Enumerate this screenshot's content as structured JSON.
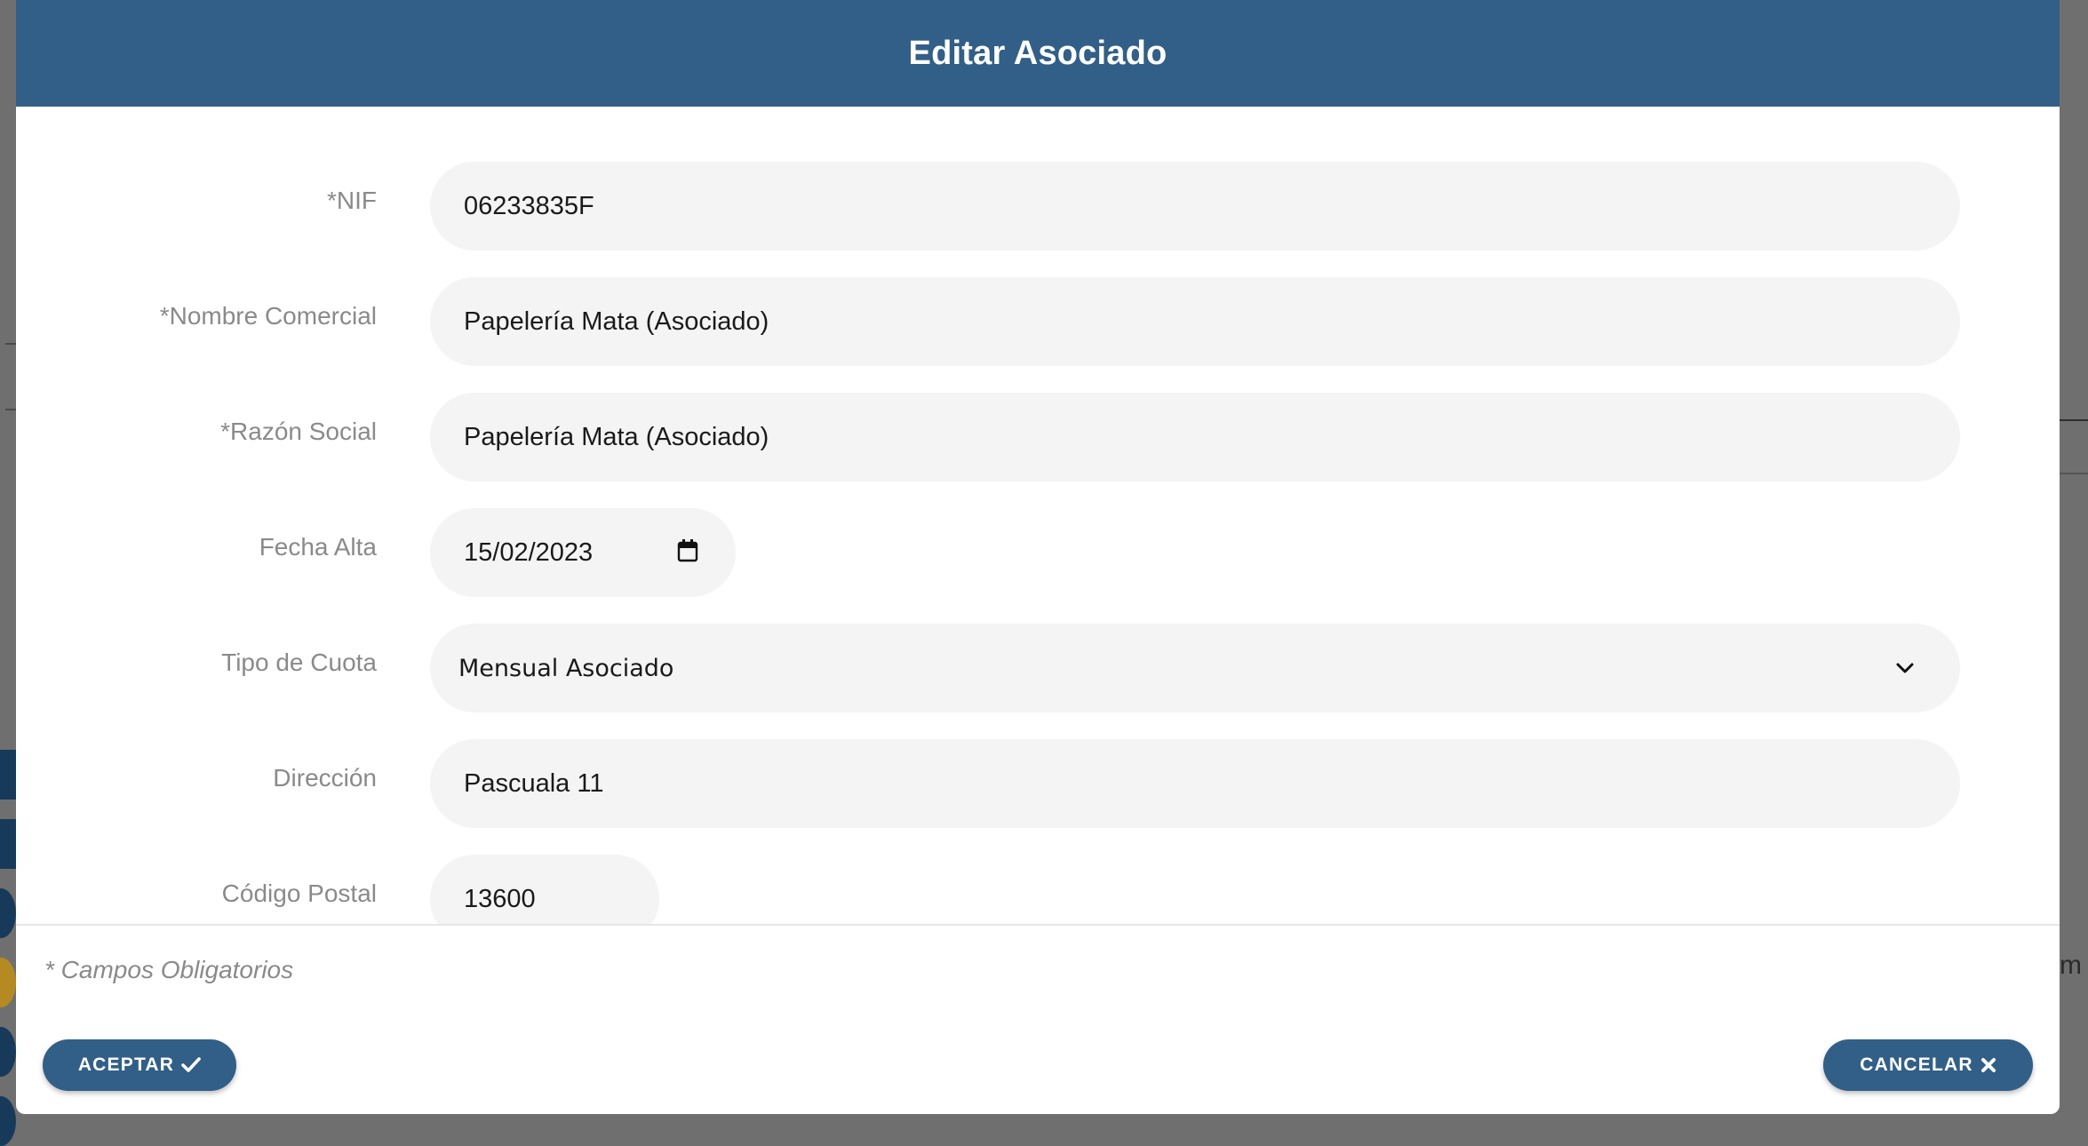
{
  "modal": {
    "title": "Editar Asociado"
  },
  "form": {
    "fields": [
      {
        "label": "*NIF",
        "value": "06233835F"
      },
      {
        "label": "*Nombre Comercial",
        "value": "Papelería Mata (Asociado)"
      },
      {
        "label": "*Razón Social",
        "value": "Papelería Mata (Asociado)"
      },
      {
        "label": "Fecha Alta",
        "value": "15/02/2023",
        "icon": "calendar-icon"
      },
      {
        "label": "Tipo de Cuota",
        "value": "Mensual Asociado",
        "icon": "chevron-down-icon"
      },
      {
        "label": "Dirección",
        "value": "Pascuala 11"
      },
      {
        "label": "Código Postal",
        "value": "13600"
      }
    ]
  },
  "footer": {
    "required_note": "* Campos Obligatorios",
    "accept_label": "ACEPTAR",
    "accept_icon": "check-icon",
    "cancel_label": "CANCELAR",
    "cancel_icon": "close-icon"
  },
  "background": {
    "partial_text": "m"
  },
  "colors": {
    "header": "#325f87",
    "button": "#325f87",
    "input_bg": "#f4f4f4",
    "label": "#8a8a8a"
  }
}
